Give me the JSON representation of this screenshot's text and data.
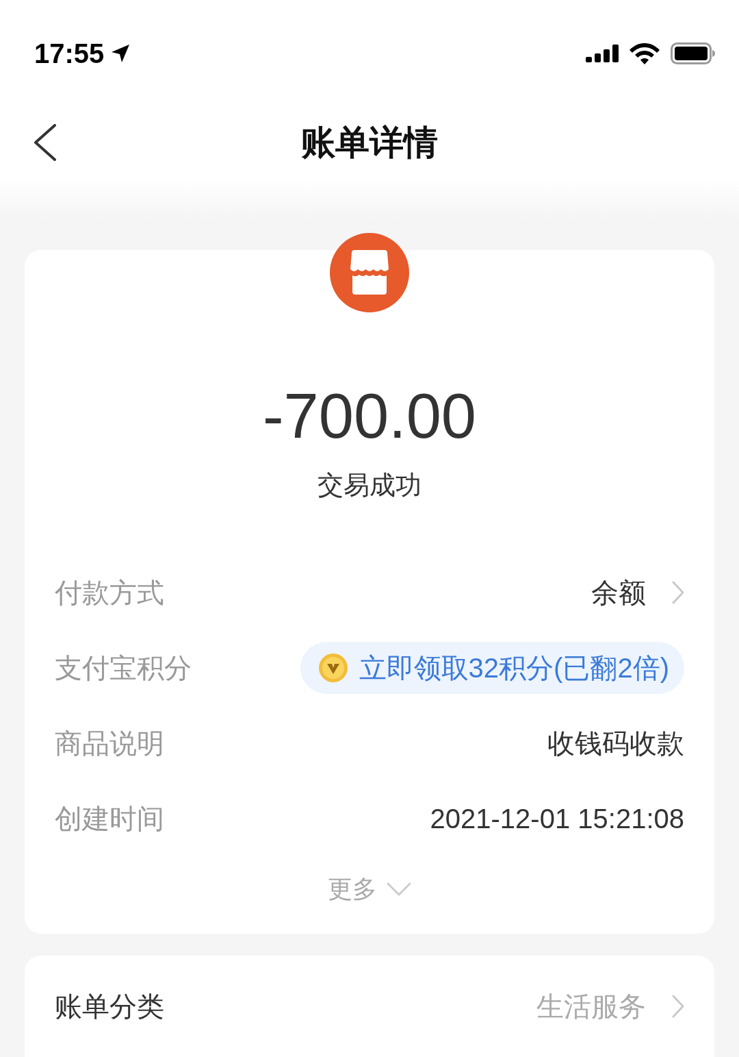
{
  "status_bar": {
    "time": "17:55"
  },
  "header": {
    "title": "账单详情"
  },
  "summary": {
    "amount": "-700.00",
    "status": "交易成功"
  },
  "details": [
    {
      "kind": "link",
      "label": "付款方式",
      "value": "余额"
    },
    {
      "kind": "points",
      "label": "支付宝积分",
      "value": "立即领取32积分(已翻2倍)"
    },
    {
      "kind": "text",
      "label": "商品说明",
      "value": "收钱码收款"
    },
    {
      "kind": "text",
      "label": "创建时间",
      "value": "2021-12-01 15:21:08"
    }
  ],
  "more": {
    "label": "更多"
  },
  "category": {
    "label": "账单分类",
    "value": "生活服务"
  }
}
